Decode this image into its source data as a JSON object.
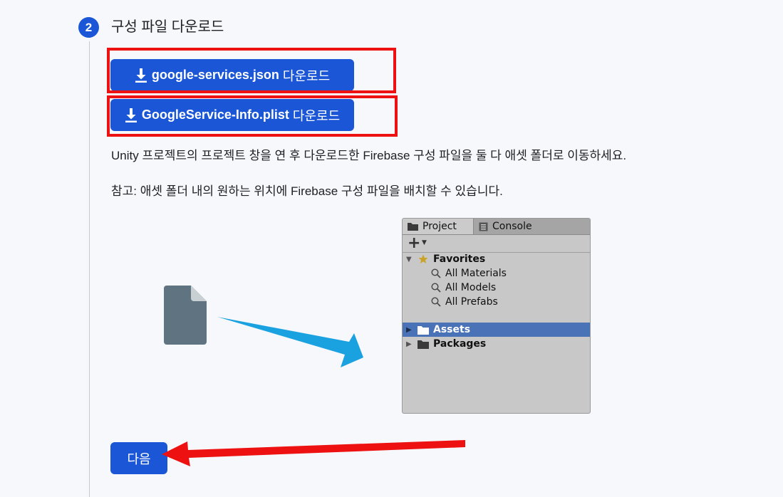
{
  "step": {
    "number": "2",
    "title": "구성 파일 다운로드"
  },
  "downloads": [
    {
      "filename": "google-services.json",
      "suffix": "다운로드"
    },
    {
      "filename": "GoogleService-Info.plist",
      "suffix": "다운로드"
    }
  ],
  "instructions": {
    "line1": "Unity 프로젝트의 프로젝트 창을 연 후 다운로드한 Firebase 구성 파일을 둘 다 애셋 폴더로 이동하세요.",
    "line2": "참고: 애셋 폴더 내의 원하는 위치에 Firebase 구성 파일을 배치할 수 있습니다."
  },
  "unity_panel": {
    "tabs": [
      "Project",
      "Console"
    ],
    "favorites_label": "Favorites",
    "favorites_items": [
      "All Materials",
      "All Models",
      "All Prefabs"
    ],
    "folders": [
      "Assets",
      "Packages"
    ]
  },
  "next_button": {
    "label": "다음"
  },
  "colors": {
    "primary": "#1a56d6",
    "highlight": "#ee1111",
    "arrow_blue": "#1aa1e0",
    "file_icon": "#5f7480",
    "selection": "#4a72b6",
    "favorite_star": "#c9a227"
  },
  "icons": {
    "download": "download-icon",
    "folder": "folder-icon",
    "search": "search-icon",
    "star": "star-icon",
    "console": "console-icon",
    "plus": "plus-icon",
    "file": "file-icon"
  }
}
